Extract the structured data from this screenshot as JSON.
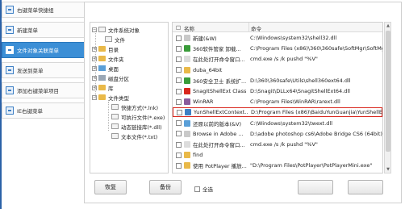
{
  "sidebar": {
    "items": [
      {
        "label": "右键菜单快捷组",
        "active": false,
        "icon": "list-icon"
      },
      {
        "label": "新建菜单",
        "active": false,
        "icon": "new-file-icon"
      },
      {
        "label": "文件对象关联菜单",
        "active": true,
        "icon": "file-link-icon"
      },
      {
        "label": "发送到菜单",
        "active": false,
        "icon": "send-icon"
      },
      {
        "label": "添加右键菜单项目",
        "active": false,
        "icon": "add-icon"
      },
      {
        "label": "IE右键菜单",
        "active": false,
        "icon": "ie-icon"
      }
    ]
  },
  "tree": {
    "nodes": [
      {
        "label": "文件系统对象",
        "icon": "doc"
      },
      {
        "label": "文件",
        "icon": "doc"
      },
      {
        "label": "目录",
        "icon": "folder"
      },
      {
        "label": "文件夹",
        "icon": "folder"
      },
      {
        "label": "桌面",
        "icon": "blue"
      },
      {
        "label": "磁盘分区",
        "icon": "gray"
      },
      {
        "label": "库",
        "icon": "folder"
      },
      {
        "label": "文件类型",
        "icon": "folder"
      },
      {
        "label": "快捷方式(*.lnk)",
        "icon": "doc"
      },
      {
        "label": "可执行文件(*.exe)",
        "icon": "doc"
      },
      {
        "label": "动态链接库(*.dll)",
        "icon": "doc"
      },
      {
        "label": "文本文件(*.txt)",
        "icon": "doc"
      }
    ]
  },
  "list": {
    "headers": {
      "name": "名称",
      "command": "命令"
    },
    "rows": [
      {
        "name": "新建(&W)",
        "command": "C:\\Windows\\system32\\shell32.dll",
        "icon_color": "#c9c9c9"
      },
      {
        "name": "360软件管家 卸载...",
        "command": "C:\\Program Files (x86)\\360\\360safe\\SoftMgr\\SoftMgrExt64.dll",
        "icon_color": "#3a9c3a"
      },
      {
        "name": "在此处打开命令窗口...",
        "command": "cmd.exe /s /k pushd \"%V\"",
        "icon_color": "#dcdcdc"
      },
      {
        "name": "duba_64bit",
        "command": "",
        "icon_color": "#e9b949"
      },
      {
        "name": "360安全卫士 系统扩...",
        "command": "D:\\360\\360safe\\Utils\\shell360ext64.dll",
        "icon_color": "#3a9c3a"
      },
      {
        "name": "SnagItShellExt Class",
        "command": "D:\\Snagit\\DLLx64\\SnagitShellExt64.dll",
        "icon_color": "#d9261c"
      },
      {
        "name": "WinRAR",
        "command": "C:\\Program Files\\WinRAR\\rarext.dll",
        "icon_color": "#8a5a9c"
      },
      {
        "name": "YunShellExtContext...",
        "command": "D:\\Program Files (x86)\\BaiduYunGuanjia\\YunShellExt64.dll",
        "icon_color": "#3d7fc4",
        "highlight": true
      },
      {
        "name": "还原以前的版本(&V)",
        "command": "C:\\Windows\\system32\\twext.dll",
        "icon_color": "#5a9fd8"
      },
      {
        "name": "Browse in Adobe ...",
        "command": "D:\\adobe photoshop cs6\\Adobe Bridge CS6 (64bit)\\",
        "icon_color": "#c9c9c9"
      },
      {
        "name": "在此处打开命令窗口...",
        "command": "cmd.exe /s /k pushd \"%V\"",
        "icon_color": "#dcdcdc"
      },
      {
        "name": "find",
        "command": "",
        "icon_color": "#e9b949"
      },
      {
        "name": "使用 PotPlayer 播放...",
        "command": "\"D:\\Program Files\\PotPlayer\\PotPlayerMini.exe\"",
        "icon_color": "#e9b949"
      }
    ]
  },
  "buttons": {
    "restore": "恢复",
    "backup": "备份",
    "select_all": "全选"
  }
}
